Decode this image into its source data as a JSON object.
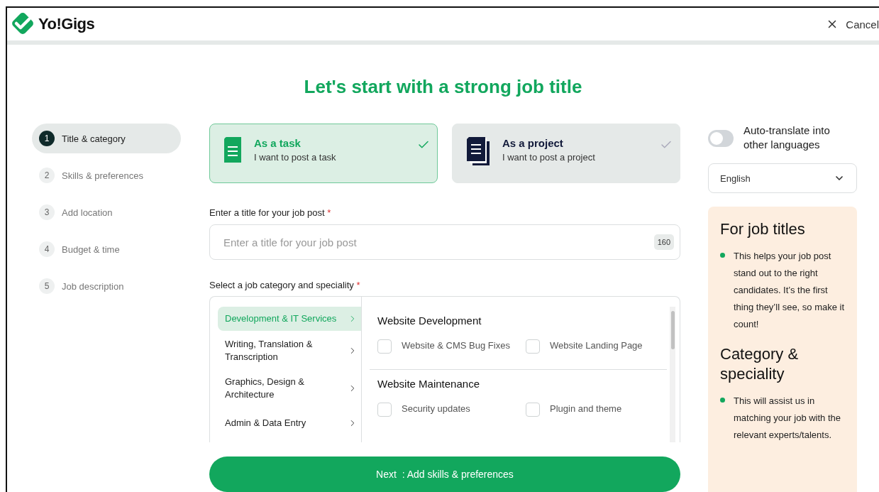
{
  "header": {
    "logo": "Yo!Gigs",
    "cancel": "Cancel"
  },
  "heading": "Let's start with a strong job title",
  "steps": [
    {
      "number": "1",
      "label": "Title & category",
      "selected": true
    },
    {
      "number": "2",
      "label": "Skills & preferences",
      "selected": false
    },
    {
      "number": "3",
      "label": "Add location",
      "selected": false
    },
    {
      "number": "4",
      "label": "Budget & time",
      "selected": false
    },
    {
      "number": "5",
      "label": "Job description",
      "selected": false
    }
  ],
  "post_types": [
    {
      "kind": "task",
      "title": "As a task",
      "subtitle": "I want to post a task",
      "selected": true
    },
    {
      "kind": "project",
      "title": "As a project",
      "subtitle": "I want to post a project",
      "selected": false
    }
  ],
  "title_field": {
    "label": "Enter a title for your job post",
    "required_mark": "*",
    "placeholder": "Enter a title for your job post",
    "counter": "160"
  },
  "category": {
    "label": "Select a job category and speciality",
    "required_mark": "*",
    "categories": [
      {
        "label": "Development & IT Services",
        "selected": true
      },
      {
        "label": "Writing, Translation & Transcription",
        "selected": false
      },
      {
        "label": "Graphics, Design & Architecture",
        "selected": false
      },
      {
        "label": "Admin & Data Entry",
        "selected": false
      }
    ],
    "groups": [
      {
        "title": "Website Development",
        "options": [
          {
            "label": "Website & CMS Bug Fixes",
            "checked": false
          },
          {
            "label": "Website Landing Page",
            "checked": false
          }
        ]
      },
      {
        "title": "Website Maintenance",
        "options": [
          {
            "label": "Security updates",
            "checked": false
          },
          {
            "label": "Plugin and theme",
            "checked": false
          }
        ]
      }
    ]
  },
  "next_button": "Next  : Add skills & preferences",
  "auto_translate": {
    "label": "Auto-translate into other languages",
    "on": false
  },
  "language": {
    "value": "English"
  },
  "tips": [
    {
      "title": "For job titles",
      "text": "This helps your job post stand out to the right candidates. It’s the first thing they’ll see, so make it count!"
    },
    {
      "title": "Category & speciality",
      "text": "This will assist us in matching your job with the relevant experts/talents."
    }
  ]
}
